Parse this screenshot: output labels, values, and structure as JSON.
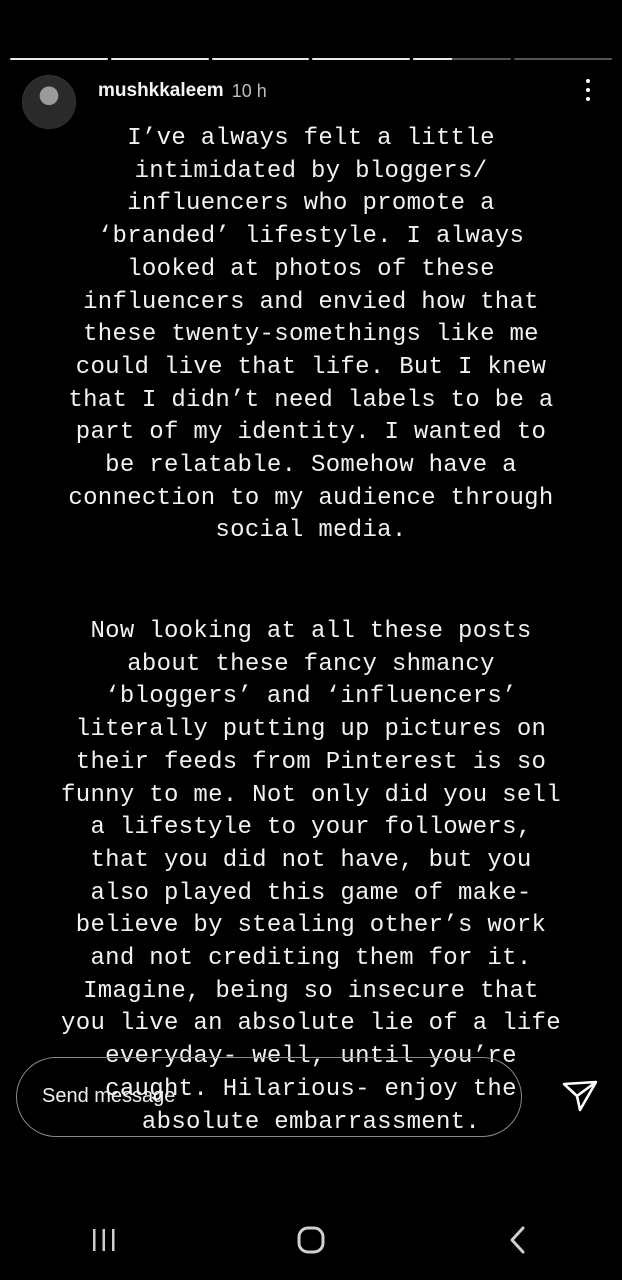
{
  "story": {
    "segments_total": 6,
    "current_segment_index": 4,
    "username": "mushkkaleem",
    "time_ago": "10 h",
    "more_icon": "more-vertical-icon",
    "paragraph1": [
      "I’ve always felt a little",
      "intimidated by bloggers/",
      "influencers who promote a",
      "‘branded’ lifestyle. I always",
      "looked at photos of these",
      "influencers and envied how that",
      "these twenty-somethings like me",
      "could live that life. But I knew",
      "that I didn’t need labels to be a",
      "part of my identity. I wanted to",
      "be relatable. Somehow have a",
      "connection to my audience through",
      "social media."
    ],
    "paragraph2": [
      "Now looking at all these posts",
      "about these fancy shmancy",
      "‘bloggers’ and ‘influencers’",
      "literally putting up pictures on",
      "their feeds from Pinterest is so",
      "funny to me. Not only did you sell",
      "a lifestyle to your followers,",
      "that you did not have, but you",
      "also played this game of make-",
      "believe by stealing other’s work",
      "and not crediting them for it.",
      "Imagine, being so insecure that",
      "you live an absolute lie of a life",
      "everyday- well, until you’re",
      "caught. Hilarious- enjoy the",
      "absolute embarrassment."
    ]
  },
  "message": {
    "placeholder": "Send message",
    "send_icon": "send-icon"
  },
  "navbar": {
    "recents_icon": "recent-apps-icon",
    "home_icon": "home-icon",
    "back_icon": "back-icon"
  }
}
